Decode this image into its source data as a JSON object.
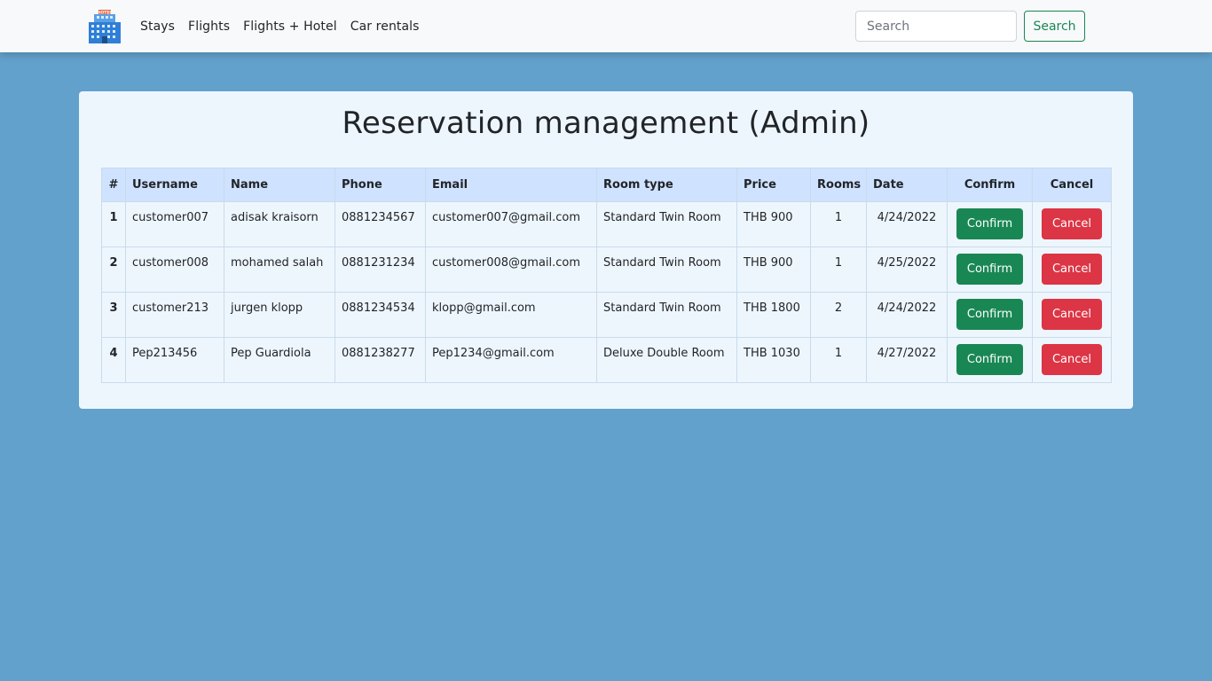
{
  "nav": {
    "logo_icon": "hotel-building-icon",
    "links": [
      "Stays",
      "Flights",
      "Flights + Hotel",
      "Car rentals"
    ],
    "search_placeholder": "Search",
    "search_button": "Search"
  },
  "page": {
    "title": "Reservation management (Admin)",
    "background_color": "#62a1cb",
    "header_color": "#cfe2ff",
    "confirm_color": "#198754",
    "cancel_color": "#dc3545"
  },
  "table": {
    "headers": [
      "#",
      "Username",
      "Name",
      "Phone",
      "Email",
      "Room type",
      "Price",
      "Rooms",
      "Date",
      "Confirm",
      "Cancel"
    ],
    "rows": [
      {
        "num": "1",
        "username": "customer007",
        "name": "adisak kraisorn",
        "phone": "0881234567",
        "email": "customer007@gmail.com",
        "room_type": "Standard Twin Room",
        "price": "THB 900",
        "rooms": "1",
        "date": "4/24/2022",
        "confirm": "Confirm",
        "cancel": "Cancel"
      },
      {
        "num": "2",
        "username": "customer008",
        "name": "mohamed salah",
        "phone": "0881231234",
        "email": "customer008@gmail.com",
        "room_type": "Standard Twin Room",
        "price": "THB 900",
        "rooms": "1",
        "date": "4/25/2022",
        "confirm": "Confirm",
        "cancel": "Cancel"
      },
      {
        "num": "3",
        "username": "customer213",
        "name": "jurgen klopp",
        "phone": "0881234534",
        "email": "klopp@gmail.com",
        "room_type": "Standard Twin Room",
        "price": "THB 1800",
        "rooms": "2",
        "date": "4/24/2022",
        "confirm": "Confirm",
        "cancel": "Cancel"
      },
      {
        "num": "4",
        "username": "Pep213456",
        "name": "Pep Guardiola",
        "phone": "0881238277",
        "email": "Pep1234@gmail.com",
        "room_type": "Deluxe Double Room",
        "price": "THB 1030",
        "rooms": "1",
        "date": "4/27/2022",
        "confirm": "Confirm",
        "cancel": "Cancel"
      }
    ]
  }
}
